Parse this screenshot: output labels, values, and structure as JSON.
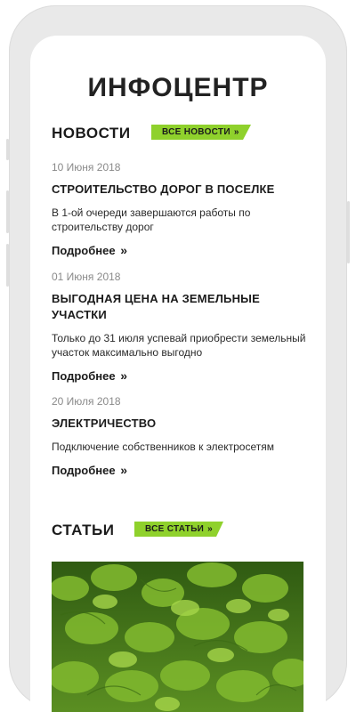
{
  "page_title": "ИНФОЦЕНТР",
  "news_section": {
    "title": "НОВОСТИ",
    "all_link": "ВСЕ НОВОСТИ",
    "chevron": "»",
    "items": [
      {
        "date": "10 Июня 2018",
        "title": "СТРОИТЕЛЬСТВО ДОРОГ В ПОСЕЛКЕ",
        "text": "В 1-ой очереди завершаются работы по строительству дорог",
        "more": "Подробнее"
      },
      {
        "date": "01 Июня 2018",
        "title": "ВЫГОДНАЯ ЦЕНА НА ЗЕМЕЛЬНЫЕ УЧАСТКИ",
        "text": "Только до 31 июля успевай приобрести земельный участок максимально выгодно",
        "more": "Подробнее"
      },
      {
        "date": "20 Июля 2018",
        "title": "ЭЛЕКТРИЧЕСТВО",
        "text": "Подключение собственников к электросетям",
        "more": "Подробнее"
      }
    ]
  },
  "articles_section": {
    "title": "СТАТЬИ",
    "all_link": "ВСЕ СТАТЬИ",
    "chevron": "»"
  },
  "colors": {
    "accent": "#8fd12c",
    "text": "#1b1b1b",
    "muted": "#8a8a8a",
    "phone_frame": "#e9e9e9"
  },
  "icons": [
    "chevron-right-double-icon",
    "camera-icon",
    "speaker-icon"
  ]
}
